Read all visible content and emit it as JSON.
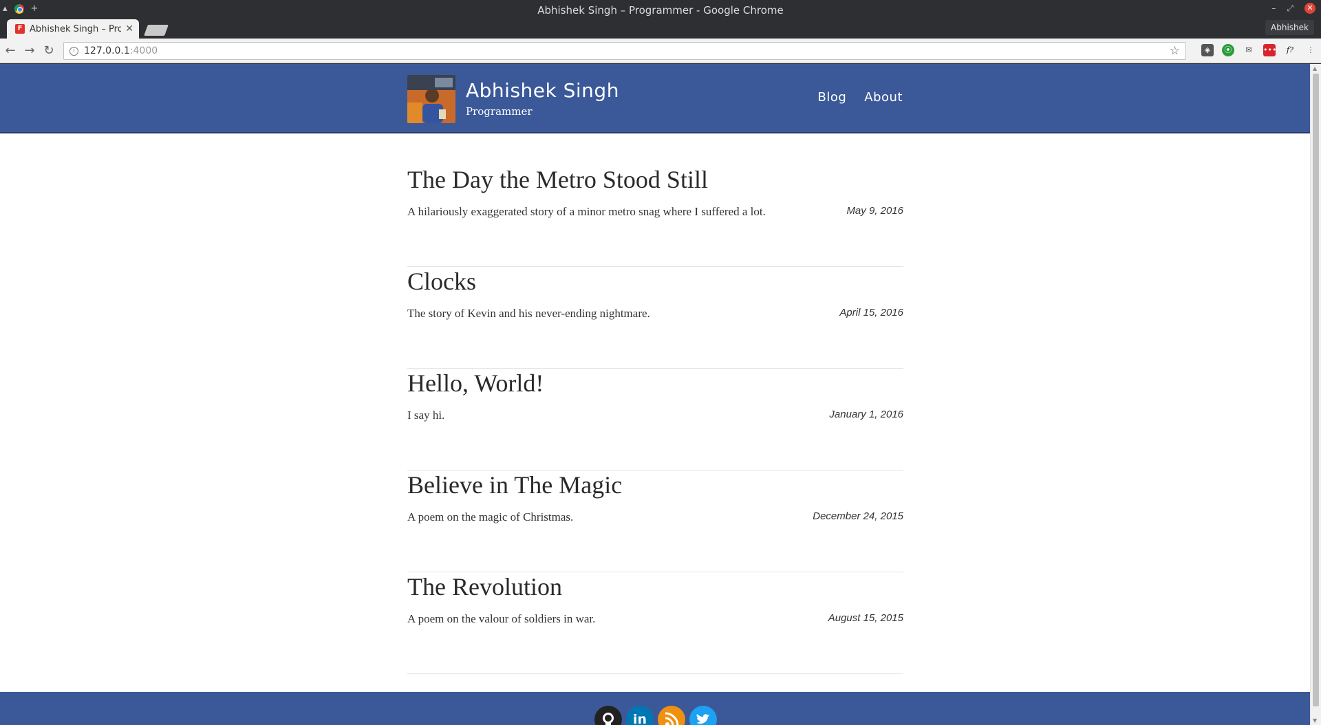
{
  "window": {
    "title": "Abhishek Singh – Programmer - Google Chrome"
  },
  "tabs": [
    {
      "label": "Abhishek Singh – Prog",
      "favicon": "F"
    }
  ],
  "profile": {
    "name": "Abhishek"
  },
  "address": {
    "host": "127.0.0.1",
    "port": ":4000"
  },
  "site": {
    "name": "Abhishek Singh",
    "tagline": "Programmer",
    "nav": [
      "Blog",
      "About"
    ]
  },
  "posts": [
    {
      "title": "The Day the Metro Stood Still",
      "description": "A hilariously exaggerated story of a minor metro snag where I suffered a lot.",
      "date": "May 9, 2016"
    },
    {
      "title": "Clocks",
      "description": "The story of Kevin and his never-ending nightmare.",
      "date": "April 15, 2016"
    },
    {
      "title": "Hello, World!",
      "description": "I say hi.",
      "date": "January 1, 2016"
    },
    {
      "title": "Believe in The Magic",
      "description": "A poem on the magic of Christmas.",
      "date": "December 24, 2015"
    },
    {
      "title": "The Revolution",
      "description": "A poem on the valour of soldiers in war.",
      "date": "August 15, 2015"
    }
  ],
  "footer": {
    "social": [
      {
        "icon": "github-icon",
        "glyph": "",
        "color": "#222222"
      },
      {
        "icon": "linkedin-icon",
        "glyph": "in",
        "color": "#0077b5"
      },
      {
        "icon": "rss-icon",
        "glyph": "",
        "color": "#f0900f"
      },
      {
        "icon": "twitter-icon",
        "glyph": "",
        "color": "#1da1f2"
      }
    ]
  },
  "colors": {
    "header": "#3b5998",
    "footer": "#3b5998"
  }
}
